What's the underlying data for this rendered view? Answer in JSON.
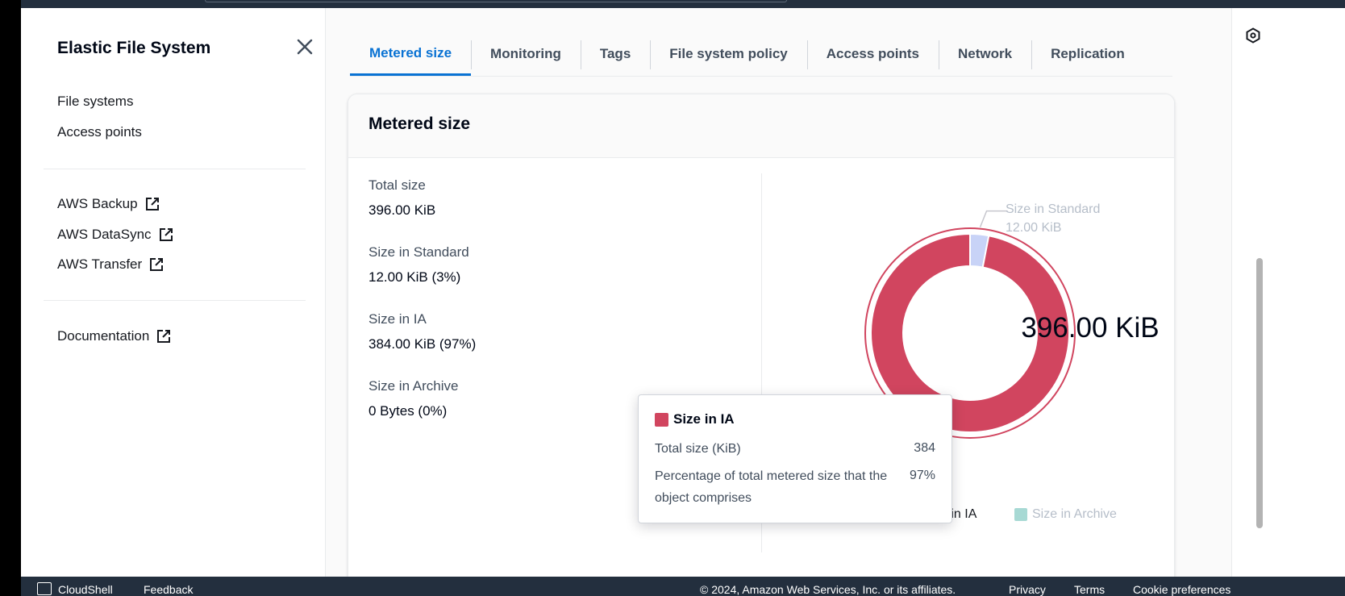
{
  "sidebar": {
    "title": "Elastic File System",
    "links": [
      "File systems",
      "Access points"
    ],
    "external_links": [
      "AWS Backup",
      "AWS DataSync",
      "AWS Transfer"
    ],
    "docs_link": "Documentation"
  },
  "tabs": [
    {
      "label": "Metered size",
      "active": true
    },
    {
      "label": "Monitoring"
    },
    {
      "label": "Tags"
    },
    {
      "label": "File system policy"
    },
    {
      "label": "Access points"
    },
    {
      "label": "Network"
    },
    {
      "label": "Replication"
    }
  ],
  "panel": {
    "title": "Metered size",
    "total_label": "Total size",
    "total_value": "396.00 KiB",
    "standard_label": "Size in Standard",
    "standard_value": "12.00 KiB (3%)",
    "ia_label": "Size in IA",
    "ia_value": "384.00 KiB (97%)",
    "archive_label": "Size in Archive",
    "archive_value": "0 Bytes (0%)"
  },
  "chart_data": {
    "type": "pie",
    "center_label": "396.00 KiB",
    "categories": [
      "Size in Standard",
      "Size in IA",
      "Size in Archive"
    ],
    "values": [
      12,
      384,
      0
    ],
    "unit": "KiB",
    "colors": [
      "#c8d3f7",
      "#d1455f",
      "#a7d9d4"
    ],
    "callout": {
      "name": "Size in Standard",
      "value": "12.00 KiB"
    },
    "legend": [
      "Size in Standard",
      "Size in IA",
      "Size in Archive"
    ],
    "legend_visible_text": [
      "",
      "ze in IA",
      "Size in Archive"
    ]
  },
  "tooltip": {
    "title": "Size in IA",
    "rows": [
      {
        "label": "Total size (KiB)",
        "value": "384"
      },
      {
        "label": "Percentage of total metered size that the object comprises",
        "value": "97%"
      }
    ]
  },
  "footer": {
    "cloudshell": "CloudShell",
    "feedback": "Feedback",
    "copyright": "© 2024, Amazon Web Services, Inc. or its affiliates.",
    "privacy": "Privacy",
    "terms": "Terms",
    "cookies": "Cookie preferences"
  }
}
